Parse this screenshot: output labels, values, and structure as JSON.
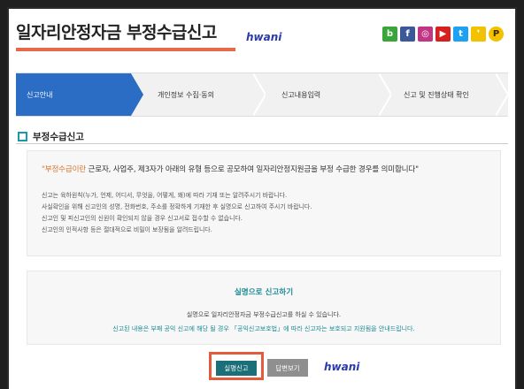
{
  "header": {
    "title": "일자리안정자금 부정수급신고",
    "watermark": "hwani"
  },
  "social": [
    {
      "icon": "blog-icon",
      "glyph": "b",
      "color": "#3aa63a"
    },
    {
      "icon": "facebook-icon",
      "glyph": "f",
      "color": "#3b5998"
    },
    {
      "icon": "instagram-icon",
      "glyph": "◎",
      "color": "#c13584"
    },
    {
      "icon": "youtube-icon",
      "glyph": "▶",
      "color": "#d62020"
    },
    {
      "icon": "twitter-icon",
      "glyph": "t",
      "color": "#1da1f2"
    },
    {
      "icon": "kakaostory-icon",
      "glyph": "❜",
      "color": "#f2c200"
    },
    {
      "icon": "kakaotalk-icon",
      "glyph": "P",
      "color": "#f2c200"
    }
  ],
  "steps": [
    {
      "label": "신고안내",
      "active": true
    },
    {
      "label": "개인정보 수집·동의",
      "active": false
    },
    {
      "label": "신고내용입력",
      "active": false
    },
    {
      "label": "신고 및 진행상태 확인",
      "active": false
    }
  ],
  "section": {
    "title": "부정수급신고"
  },
  "info": {
    "lead_highlight": "\"부정수급이란",
    "lead_rest": " 근로자, 사업주, 제3자가 아래의 유형 등으로 공모하여 일자리안정지원금을 부정 수급한 경우를 의미합니다\"",
    "lines": [
      "신고는 육하원칙(누가, 언제, 어디서, 무엇을, 어떻게, 왜)에 따라 기재 또는 알려주시기 바랍니다.",
      "사실확인을 위해 신고인의 성명, 전화번호, 주소를 정확하게 기재한 후 실명으로 신고하여 주시기 바랍니다.",
      "신고인 및 피신고인의 신원이 확인되지 않을 경우 신고서로 접수할 수 없습니다.",
      "신고인의 인적사항 등은 절대적으로 비밀이 보장됨을 알려드립니다."
    ]
  },
  "realname": {
    "heading": "실명으로 신고하기",
    "text1": "실명으로 일자리안정자금 부정수급신고를 하실 수 있습니다.",
    "text2": "신고된 내용은 부패 공익 신고에 해당 될 경우 「공익신고보호법」에 따라 신고자는 보호되고 지원됨을 안내드립니다."
  },
  "buttons": {
    "realname_report": "실명신고",
    "answer_view": "답변보기"
  }
}
